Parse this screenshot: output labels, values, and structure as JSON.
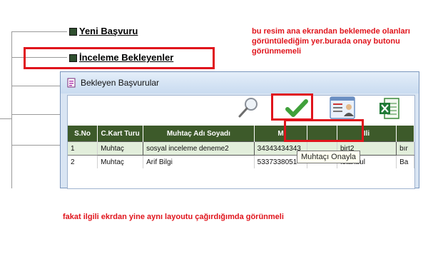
{
  "menu": {
    "items": [
      {
        "label": "Yeni Başvuru"
      },
      {
        "label": "İnceleme Bekleyenler"
      }
    ]
  },
  "notes": {
    "top": "bu resim ana ekrandan beklemede olanları görüntülediğim yer.burada onay butonu görünmemeli",
    "bottom": "fakat ilgili ekrdan yine aynı layoutu çağırdığımda görünmeli"
  },
  "window": {
    "title": "Bekleyen Başvurular",
    "toolbar": {
      "tooltip": "Muhtaçı Onayla",
      "icons": [
        "magnifier-icon",
        "checkmark-icon",
        "id-card-icon",
        "excel-icon"
      ]
    },
    "table": {
      "columns": [
        "S.No",
        "C.Kart Turu",
        "Muhtaç Adı Soyadı",
        "M",
        "",
        "Ili",
        ""
      ],
      "rows": [
        [
          "1",
          "Muhtaç",
          "sosyal inceleme deneme2",
          "34343434343",
          "",
          "birt2",
          "bır"
        ],
        [
          "2",
          "Muhtaç",
          "Arif Bilgi",
          "5337338051",
          "",
          "İstanbul",
          "Ba"
        ]
      ]
    }
  },
  "colors": {
    "accent_red": "#e0141c",
    "header_green": "#3d5a2a"
  }
}
